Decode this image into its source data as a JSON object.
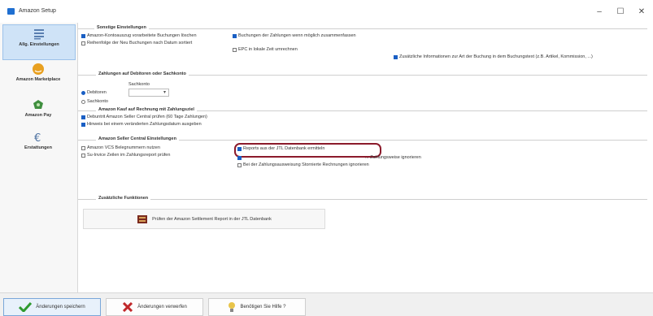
{
  "window": {
    "title": "Amazon Setup",
    "minimize": "–",
    "maximize": "☐",
    "close": "✕"
  },
  "sidebar": {
    "items": [
      {
        "label": "Allg. Einstellungen",
        "icon": "list-icon"
      },
      {
        "label": "Amazon Marketplace",
        "icon": "amazon-icon"
      },
      {
        "label": "Amazon Pay",
        "icon": "amazon-pay-icon"
      },
      {
        "label": "Erstattungen",
        "icon": "euro-icon"
      }
    ]
  },
  "sections": {
    "sonstige": {
      "title": "Sonstige Einstellungen",
      "cb1": "Amazon-Kontoauszug vorarbeitete Buchungen löschen",
      "cb2": "Buchungen der Zahlungen wenn möglich zusammenfassen",
      "cb3": "Reihenfolge der Neu Buchungen nach Datum sortiert",
      "cb4": "EPC in lokale Zeit umrechnen",
      "cb5": "Zusätzliche Informationen zur Art der Buchung in dem Buchungstext (z.B. Artikel, Kommission, ...)"
    },
    "zahlungen": {
      "title": "Zahlungen auf Debitoren oder Sachkonto",
      "radio1": "Debitoren",
      "radio2": "Sachkonto",
      "sachkonto_label": "Sachkonto"
    },
    "kauf": {
      "title": "Amazon Kauf auf Rechnung mit Zahlungsziel",
      "cb1": "Debuntrit Amazon Seller Central prüfen (60 Tage Zahlungen)",
      "cb2": "Hinweis bei einem veränderten Zahlungsdatum ausgeben"
    },
    "seller": {
      "title": "Amazon Seller Central Einstellungen",
      "cb1": "Amazon VCS Belegnummern nutzen",
      "cb2": "Su-Invice Zeilen im Zahlungsreport prüfen",
      "cb3": "Reports aus der JTL Datenbank ermitteln",
      "cb4": "... Zahlungsweise ignorieren",
      "cb5": "Bei der Zahlungsausweisung Stornierte Rechnungen ignorieren"
    },
    "zusatz": {
      "title": "Zusätzliche Funktionen",
      "button": "Prüfen der Amazon Settlement Report in der JTL Datenbank"
    }
  },
  "footer": {
    "save": "Änderungen speichern",
    "discard": "Änderungen verwerfen",
    "help": "Benötigen Sie Hilfe ?"
  },
  "colors": {
    "accent": "#1a5fc4",
    "highlight": "#8b1a2b",
    "save_icon": "#2f9a2f",
    "discard_icon": "#c0282b"
  }
}
